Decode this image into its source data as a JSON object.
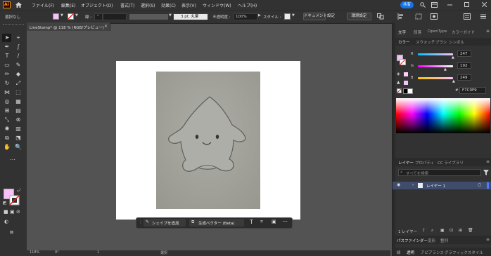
{
  "app": {
    "logo_text": "Ai"
  },
  "menu": [
    "ファイル(F)",
    "編集(E)",
    "オブジェクト(O)",
    "書式(T)",
    "選択(S)",
    "効果(C)",
    "表示(V)",
    "ウィンドウ(W)",
    "ヘルプ(H)"
  ],
  "share_label": "共有",
  "control": {
    "selection_label": "選択なし",
    "stroke_label": "線 :",
    "stroke_weight": "3 pt. 丸筆",
    "opacity_label": "不透明度 :",
    "opacity_value": "100%",
    "style_label": "スタイル :",
    "doc_settings": "ドキュメント設定",
    "prefs": "環境設定"
  },
  "document_tab": {
    "title": "LineStamp* @ 118 % (RGB/プレビュー)",
    "close": "×"
  },
  "context_bar": {
    "add_shape": "シェイプを追加",
    "gen_vector": "生成ベクター (Beta)"
  },
  "status": {
    "zoom": "118%",
    "angle": "0°",
    "page": "1",
    "mode": "選択"
  },
  "panel": {
    "top_tabs": [
      "文字",
      "段落",
      "OpenType",
      "カラーガイド"
    ],
    "color_tabs": [
      "カラー",
      "スウォッチ",
      "ブラシ",
      "シンボル"
    ],
    "r": {
      "label": "R",
      "value": "247",
      "level": 0.969
    },
    "g": {
      "label": "G",
      "value": "192",
      "level": 0.753
    },
    "b": {
      "label": "B",
      "value": "249",
      "level": 0.976
    },
    "hex_symbol": "#",
    "hex_value": "F7C0F9",
    "layer_tabs": [
      "レイヤー",
      "プロパティ",
      "CC ライブラリ"
    ],
    "search_placeholder": "すべてを検索",
    "layer_name": "レイヤー 1",
    "layer_count": "1 レイヤー",
    "pathfinder_tabs": [
      "パスファインダー",
      "変形",
      "整列"
    ],
    "bottom_tabs": [
      "線",
      "透明",
      "アピアランス",
      "グラフィックスタイル"
    ]
  },
  "colors": {
    "fill": "#F7C0F9",
    "accent": "#1473e6",
    "layer_highlight": "#3f4c6c"
  }
}
